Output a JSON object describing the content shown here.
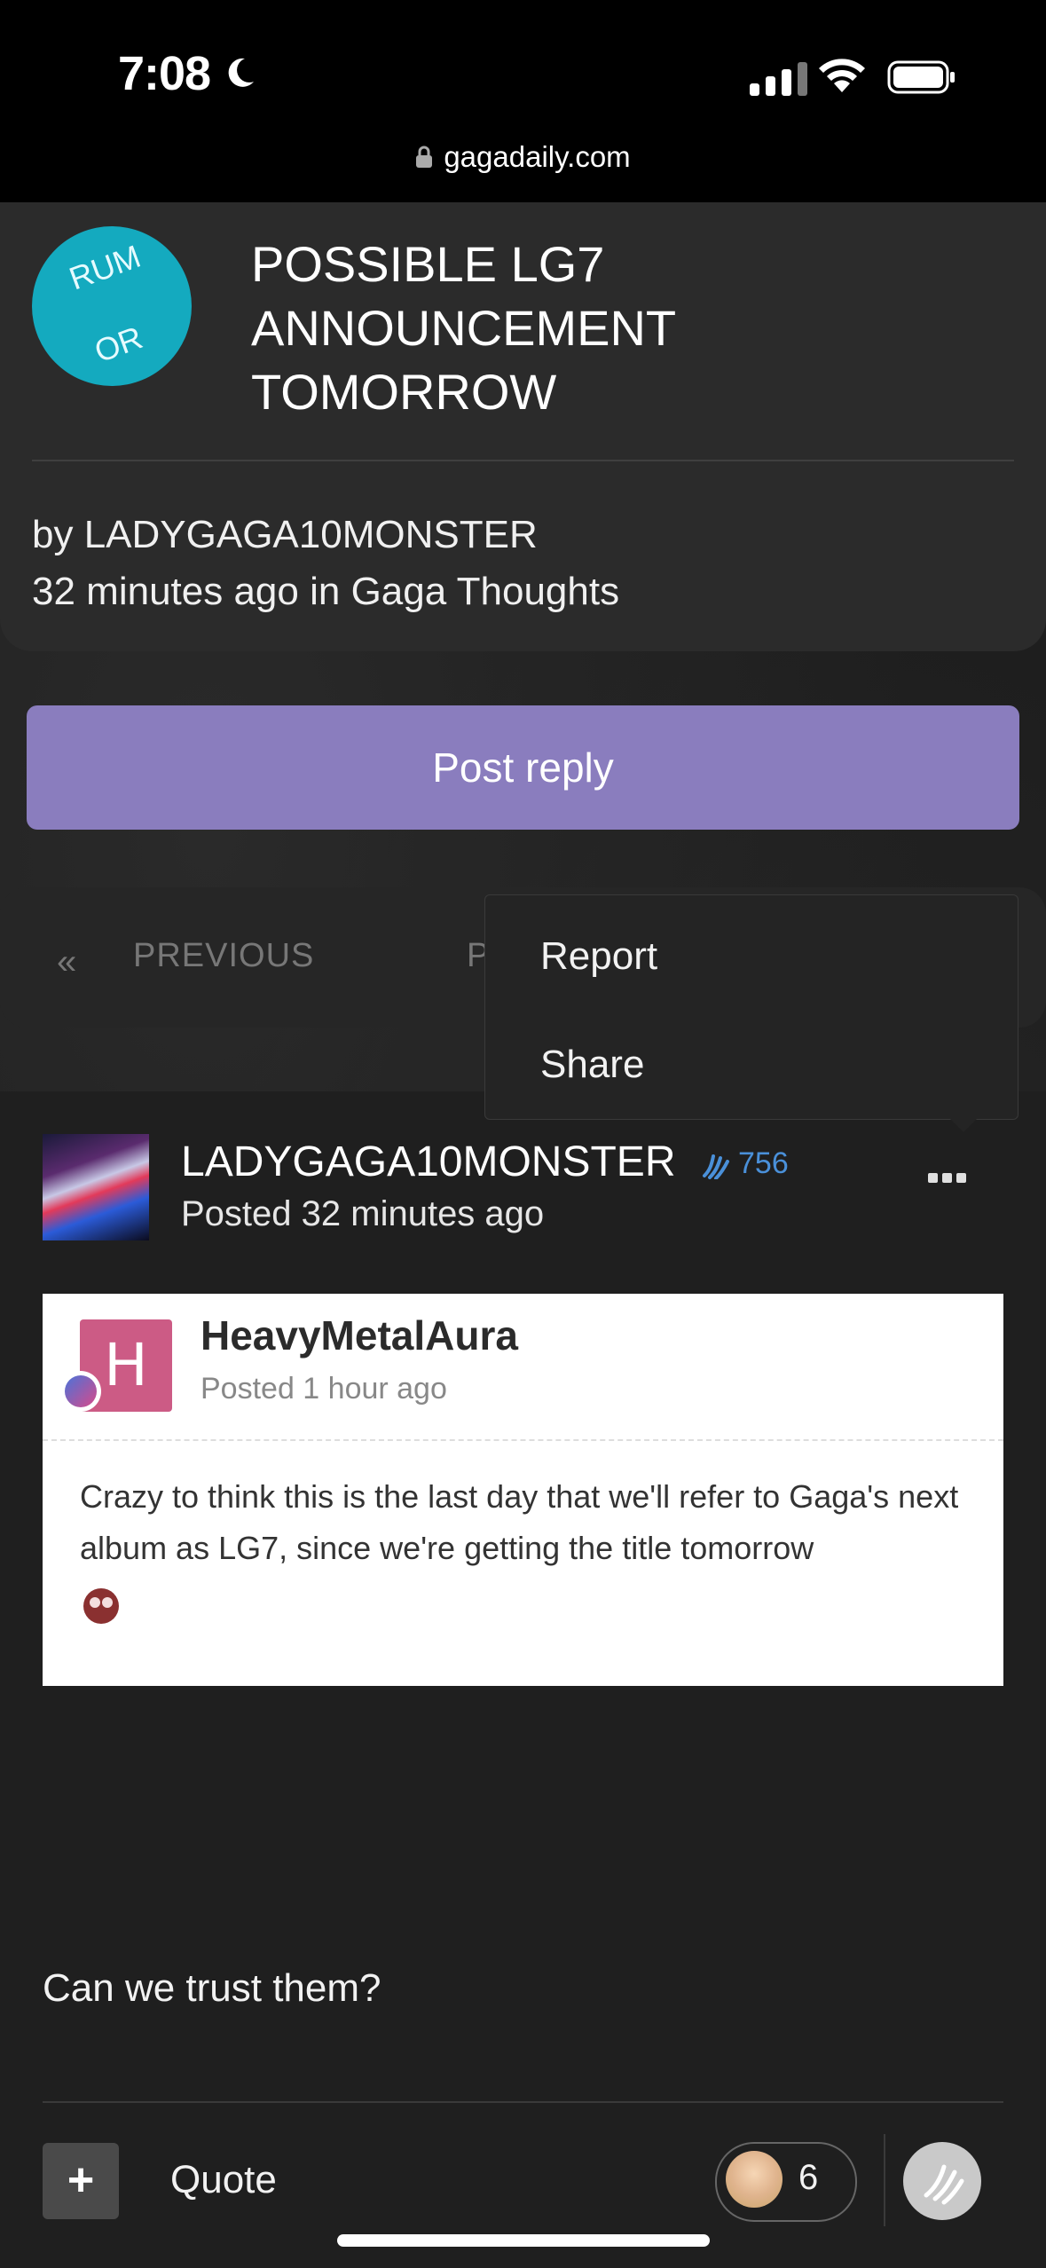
{
  "status_bar": {
    "time": "7:08",
    "url": "gagadaily.com"
  },
  "thread": {
    "badge": "RUMOR",
    "badge_line1": "RUM",
    "badge_line2": "OR",
    "title": "POSSIBLE LG7 ANNOUNCEMENT TOMORROW",
    "byline": "by LADYGAGA10MONSTER",
    "meta": "32 minutes ago in Gaga Thoughts"
  },
  "actions": {
    "post_reply": "Post reply"
  },
  "pagination": {
    "prev_chevron": "«",
    "prev_label": "PREVIOUS",
    "page_label_partial": "P"
  },
  "menu": {
    "items": [
      "Report",
      "Share"
    ]
  },
  "post": {
    "author": "LADYGAGA10MONSTER",
    "reputation": "756",
    "posted": "Posted 32 minutes ago",
    "quote": {
      "avatar_letter": "H",
      "author": "HeavyMetalAura",
      "posted": "Posted 1 hour ago",
      "text": "Crazy to think this is the last day that we'll refer to Gaga's next album as LG7, since we're getting the title tomorrow"
    },
    "body": "Can we trust them?",
    "footer": {
      "plus": "+",
      "quote_label": "Quote",
      "reaction_count": "6"
    }
  },
  "colors": {
    "accent_purple": "#8a7dbe",
    "rumor_teal": "#14aabf",
    "reputation_blue": "#4a90d9",
    "quote_avatar_pink": "#cc5b85"
  }
}
